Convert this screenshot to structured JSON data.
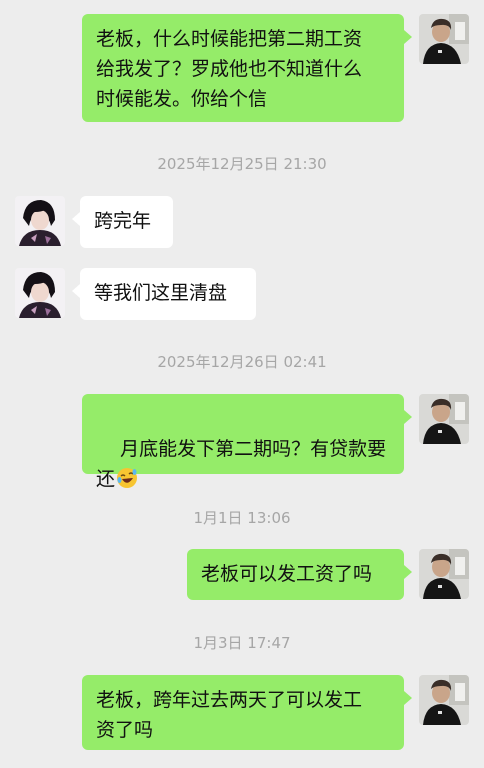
{
  "colors": {
    "background": "#ededed",
    "outgoing_bubble": "#95ec69",
    "incoming_bubble": "#ffffff",
    "timestamp_text": "#a6a6a6"
  },
  "messages": [
    {
      "text": "老板，什么时候能把第二期工资\n给我发了？罗成他也不知道什么\n时候能发。你给个信"
    },
    {
      "timestamp": "2025年12月25日 21:30"
    },
    {
      "text": "跨完年"
    },
    {
      "text": "等我们这里清盘"
    },
    {
      "timestamp": "2025年12月26日 02:41"
    },
    {
      "text": "月底能发下第二期吗？有贷款要\n还",
      "emoji": "rolling-on-floor-laughing-emoji"
    },
    {
      "timestamp": "1月1日 13:06"
    },
    {
      "text": "老板可以发工资了吗"
    },
    {
      "timestamp": "1月3日 17:47"
    },
    {
      "text": "老板，跨年过去两天了可以发工\n资了吗"
    }
  ]
}
